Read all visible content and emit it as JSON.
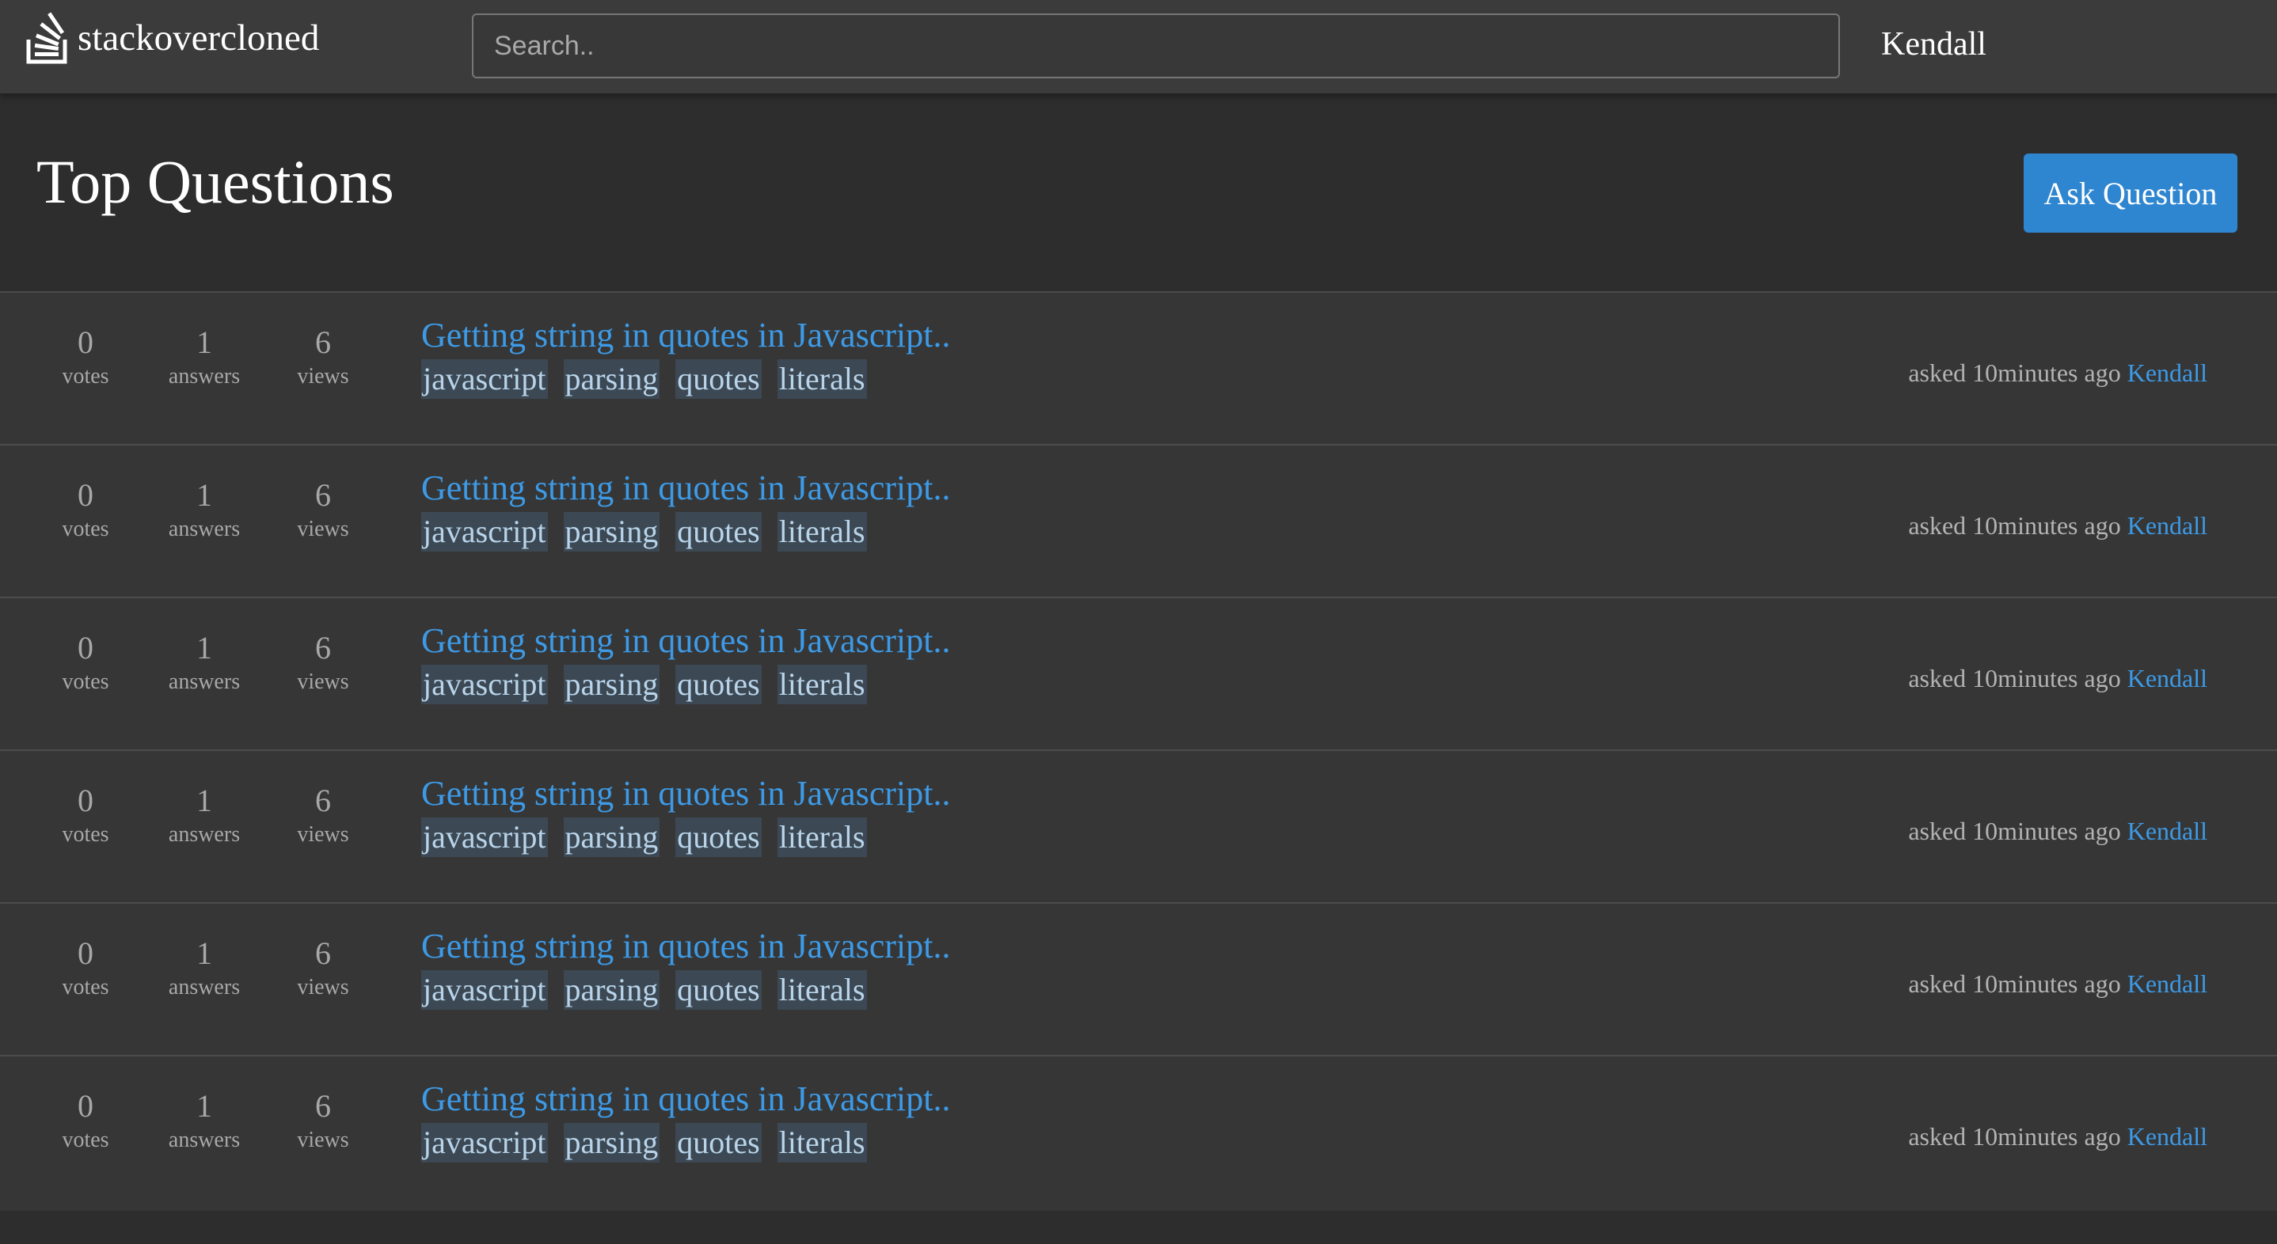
{
  "header": {
    "brand": "stackovercloned",
    "logo_icon": "stack-logo-icon",
    "search_placeholder": "Search..",
    "user_name": "Kendall"
  },
  "main": {
    "title": "Top Questions",
    "ask_button_label": "Ask Question"
  },
  "colors": {
    "accent": "#2f86d0",
    "link": "#3d9ae6",
    "background": "#2d2d2d",
    "topbar": "#3b3b3b",
    "list_background": "#363636",
    "tag_background": "#3c4954",
    "tag_text": "#b9d4ea"
  },
  "questions": [
    {
      "votes": "0",
      "votes_label": "votes",
      "answers": "1",
      "answers_label": "answers",
      "views": "6",
      "views_label": "views",
      "title": "Getting string in quotes in Javascript..",
      "tags": [
        "javascript",
        "parsing",
        "quotes",
        "literals"
      ],
      "asked_text": "asked 10minutes ago",
      "author": "Kendall"
    },
    {
      "votes": "0",
      "votes_label": "votes",
      "answers": "1",
      "answers_label": "answers",
      "views": "6",
      "views_label": "views",
      "title": "Getting string in quotes in Javascript..",
      "tags": [
        "javascript",
        "parsing",
        "quotes",
        "literals"
      ],
      "asked_text": "asked 10minutes ago",
      "author": "Kendall"
    },
    {
      "votes": "0",
      "votes_label": "votes",
      "answers": "1",
      "answers_label": "answers",
      "views": "6",
      "views_label": "views",
      "title": "Getting string in quotes in Javascript..",
      "tags": [
        "javascript",
        "parsing",
        "quotes",
        "literals"
      ],
      "asked_text": "asked 10minutes ago",
      "author": "Kendall"
    },
    {
      "votes": "0",
      "votes_label": "votes",
      "answers": "1",
      "answers_label": "answers",
      "views": "6",
      "views_label": "views",
      "title": "Getting string in quotes in Javascript..",
      "tags": [
        "javascript",
        "parsing",
        "quotes",
        "literals"
      ],
      "asked_text": "asked 10minutes ago",
      "author": "Kendall"
    },
    {
      "votes": "0",
      "votes_label": "votes",
      "answers": "1",
      "answers_label": "answers",
      "views": "6",
      "views_label": "views",
      "title": "Getting string in quotes in Javascript..",
      "tags": [
        "javascript",
        "parsing",
        "quotes",
        "literals"
      ],
      "asked_text": "asked 10minutes ago",
      "author": "Kendall"
    },
    {
      "votes": "0",
      "votes_label": "votes",
      "answers": "1",
      "answers_label": "answers",
      "views": "6",
      "views_label": "views",
      "title": "Getting string in quotes in Javascript..",
      "tags": [
        "javascript",
        "parsing",
        "quotes",
        "literals"
      ],
      "asked_text": "asked 10minutes ago",
      "author": "Kendall"
    }
  ]
}
